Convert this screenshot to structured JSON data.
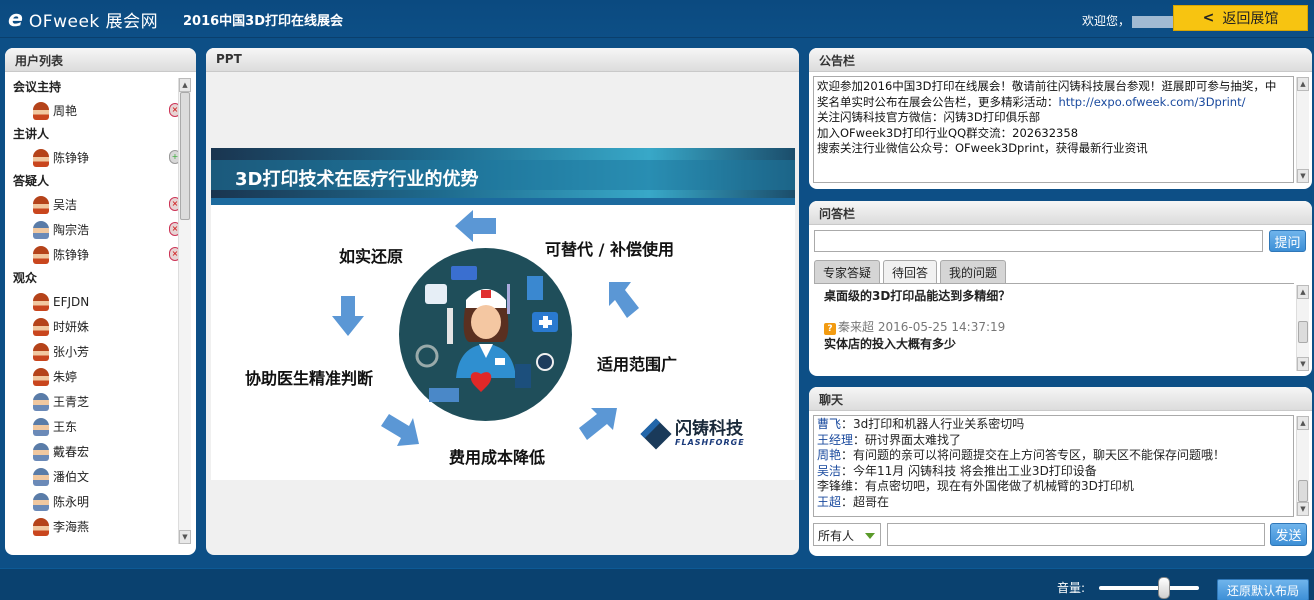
{
  "header": {
    "logo_text": "OFweek 展会网",
    "expo_title": "2016中国3D打印在线展会",
    "welcome": "欢迎您，",
    "back_button": "返回展馆"
  },
  "users_panel": {
    "title": "用户列表",
    "groups": [
      {
        "name": "会议主持",
        "members": [
          {
            "name": "周艳",
            "gender": "f",
            "mic": "muted"
          }
        ]
      },
      {
        "name": "主讲人",
        "members": [
          {
            "name": "陈铮铮",
            "gender": "f",
            "mic": "active"
          }
        ]
      },
      {
        "name": "答疑人",
        "members": [
          {
            "name": "吴洁",
            "gender": "f",
            "mic": "muted"
          },
          {
            "name": "陶宗浩",
            "gender": "m",
            "mic": "muted"
          },
          {
            "name": "陈铮铮",
            "gender": "f",
            "mic": "muted"
          }
        ]
      },
      {
        "name": "观众",
        "members": [
          {
            "name": "EFJDN",
            "gender": "f"
          },
          {
            "name": "时妍姝",
            "gender": "f"
          },
          {
            "name": "张小芳",
            "gender": "f"
          },
          {
            "name": "朱婷",
            "gender": "f"
          },
          {
            "name": "王青芝",
            "gender": "m"
          },
          {
            "name": "王东",
            "gender": "m"
          },
          {
            "name": "戴春宏",
            "gender": "m"
          },
          {
            "name": "潘伯文",
            "gender": "m"
          },
          {
            "name": "陈永明",
            "gender": "m"
          },
          {
            "name": "李海燕",
            "gender": "f"
          }
        ]
      }
    ]
  },
  "ppt_panel": {
    "title": "PPT",
    "slide_title": "3D打印技术在医疗行业的优势",
    "labels": {
      "faithful": "如实还原",
      "replace": "可替代 / 补偿使用",
      "assist": "协助医生精准判断",
      "range": "适用范围广",
      "cost": "费用成本降低"
    },
    "brand_cn": "闪铸科技",
    "brand_en": "FLASHFORGE"
  },
  "notice_panel": {
    "title": "公告栏",
    "lines": [
      "欢迎参加2016中国3D打印在线展会！敬请前往闪铸科技展台参观！逛展即可参与抽奖，中",
      "加入OFweek3D打印行业QQ群交流：202632358",
      "搜索关注行业微信公众号：OFweek3Dprint，获得最新行业资讯"
    ],
    "line2_prefix": "奖名单实时公布在展会公告栏，更多精彩活动：",
    "link": "http://expo.ofweek.com/3Dprint/",
    "line3": "关注闪铸科技官方微信：闪铸3D打印俱乐部"
  },
  "qa_panel": {
    "title": "问答栏",
    "ask_button": "提问",
    "tabs": [
      "专家答疑",
      "待回答",
      "我的问题"
    ],
    "active_tab": 1,
    "partial_question": "桌面级的3D打印品能达到多精细？",
    "items": [
      {
        "asker": "秦来超",
        "time": "2016-05-25 14:37:19",
        "question": "实体店的投入大概有多少"
      }
    ]
  },
  "chat_panel": {
    "title": "聊天",
    "messages": [
      {
        "name": "曹飞",
        "sep": "：",
        "text": "3d打印和机器人行业关系密切吗",
        "colored": true
      },
      {
        "name": "王经理",
        "sep": "：",
        "text": "研讨界面太难找了",
        "colored": true
      },
      {
        "name": "周艳",
        "sep": "：",
        "text": "有问题的亲可以将问题提交在上方问答专区，聊天区不能保存问题哦！",
        "colored": true
      },
      {
        "name": "吴洁",
        "sep": "：",
        "text": "今年11月 闪铸科技 将会推出工业3D打印设备",
        "colored": true
      },
      {
        "name": "李锋维",
        "sep": "：",
        "text": "有点密切吧，现在有外国佬做了机械臂的3D打印机",
        "colored": false
      },
      {
        "name": "王超",
        "sep": "：",
        "text": "超哥在",
        "colored": true
      }
    ],
    "recipient": "所有人",
    "send_button": "发送"
  },
  "footer": {
    "volume_label": "音量:",
    "volume_level": 0.65,
    "reset_button": "还原默认布局"
  }
}
